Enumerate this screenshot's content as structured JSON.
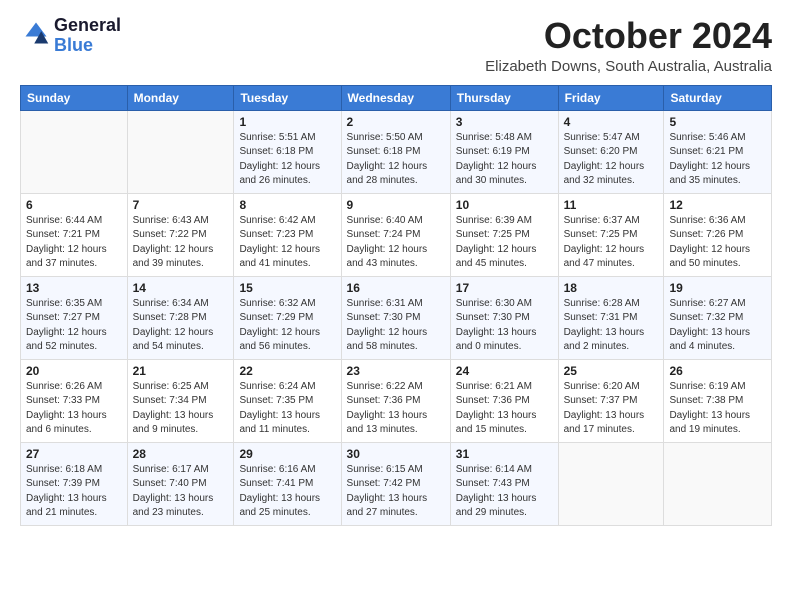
{
  "header": {
    "logo_line1": "General",
    "logo_line2": "Blue",
    "month_title": "October 2024",
    "location": "Elizabeth Downs, South Australia, Australia"
  },
  "days_of_week": [
    "Sunday",
    "Monday",
    "Tuesday",
    "Wednesday",
    "Thursday",
    "Friday",
    "Saturday"
  ],
  "weeks": [
    [
      {
        "num": "",
        "info": ""
      },
      {
        "num": "",
        "info": ""
      },
      {
        "num": "1",
        "info": "Sunrise: 5:51 AM\nSunset: 6:18 PM\nDaylight: 12 hours\nand 26 minutes."
      },
      {
        "num": "2",
        "info": "Sunrise: 5:50 AM\nSunset: 6:18 PM\nDaylight: 12 hours\nand 28 minutes."
      },
      {
        "num": "3",
        "info": "Sunrise: 5:48 AM\nSunset: 6:19 PM\nDaylight: 12 hours\nand 30 minutes."
      },
      {
        "num": "4",
        "info": "Sunrise: 5:47 AM\nSunset: 6:20 PM\nDaylight: 12 hours\nand 32 minutes."
      },
      {
        "num": "5",
        "info": "Sunrise: 5:46 AM\nSunset: 6:21 PM\nDaylight: 12 hours\nand 35 minutes."
      }
    ],
    [
      {
        "num": "6",
        "info": "Sunrise: 6:44 AM\nSunset: 7:21 PM\nDaylight: 12 hours\nand 37 minutes."
      },
      {
        "num": "7",
        "info": "Sunrise: 6:43 AM\nSunset: 7:22 PM\nDaylight: 12 hours\nand 39 minutes."
      },
      {
        "num": "8",
        "info": "Sunrise: 6:42 AM\nSunset: 7:23 PM\nDaylight: 12 hours\nand 41 minutes."
      },
      {
        "num": "9",
        "info": "Sunrise: 6:40 AM\nSunset: 7:24 PM\nDaylight: 12 hours\nand 43 minutes."
      },
      {
        "num": "10",
        "info": "Sunrise: 6:39 AM\nSunset: 7:25 PM\nDaylight: 12 hours\nand 45 minutes."
      },
      {
        "num": "11",
        "info": "Sunrise: 6:37 AM\nSunset: 7:25 PM\nDaylight: 12 hours\nand 47 minutes."
      },
      {
        "num": "12",
        "info": "Sunrise: 6:36 AM\nSunset: 7:26 PM\nDaylight: 12 hours\nand 50 minutes."
      }
    ],
    [
      {
        "num": "13",
        "info": "Sunrise: 6:35 AM\nSunset: 7:27 PM\nDaylight: 12 hours\nand 52 minutes."
      },
      {
        "num": "14",
        "info": "Sunrise: 6:34 AM\nSunset: 7:28 PM\nDaylight: 12 hours\nand 54 minutes."
      },
      {
        "num": "15",
        "info": "Sunrise: 6:32 AM\nSunset: 7:29 PM\nDaylight: 12 hours\nand 56 minutes."
      },
      {
        "num": "16",
        "info": "Sunrise: 6:31 AM\nSunset: 7:30 PM\nDaylight: 12 hours\nand 58 minutes."
      },
      {
        "num": "17",
        "info": "Sunrise: 6:30 AM\nSunset: 7:30 PM\nDaylight: 13 hours\nand 0 minutes."
      },
      {
        "num": "18",
        "info": "Sunrise: 6:28 AM\nSunset: 7:31 PM\nDaylight: 13 hours\nand 2 minutes."
      },
      {
        "num": "19",
        "info": "Sunrise: 6:27 AM\nSunset: 7:32 PM\nDaylight: 13 hours\nand 4 minutes."
      }
    ],
    [
      {
        "num": "20",
        "info": "Sunrise: 6:26 AM\nSunset: 7:33 PM\nDaylight: 13 hours\nand 6 minutes."
      },
      {
        "num": "21",
        "info": "Sunrise: 6:25 AM\nSunset: 7:34 PM\nDaylight: 13 hours\nand 9 minutes."
      },
      {
        "num": "22",
        "info": "Sunrise: 6:24 AM\nSunset: 7:35 PM\nDaylight: 13 hours\nand 11 minutes."
      },
      {
        "num": "23",
        "info": "Sunrise: 6:22 AM\nSunset: 7:36 PM\nDaylight: 13 hours\nand 13 minutes."
      },
      {
        "num": "24",
        "info": "Sunrise: 6:21 AM\nSunset: 7:36 PM\nDaylight: 13 hours\nand 15 minutes."
      },
      {
        "num": "25",
        "info": "Sunrise: 6:20 AM\nSunset: 7:37 PM\nDaylight: 13 hours\nand 17 minutes."
      },
      {
        "num": "26",
        "info": "Sunrise: 6:19 AM\nSunset: 7:38 PM\nDaylight: 13 hours\nand 19 minutes."
      }
    ],
    [
      {
        "num": "27",
        "info": "Sunrise: 6:18 AM\nSunset: 7:39 PM\nDaylight: 13 hours\nand 21 minutes."
      },
      {
        "num": "28",
        "info": "Sunrise: 6:17 AM\nSunset: 7:40 PM\nDaylight: 13 hours\nand 23 minutes."
      },
      {
        "num": "29",
        "info": "Sunrise: 6:16 AM\nSunset: 7:41 PM\nDaylight: 13 hours\nand 25 minutes."
      },
      {
        "num": "30",
        "info": "Sunrise: 6:15 AM\nSunset: 7:42 PM\nDaylight: 13 hours\nand 27 minutes."
      },
      {
        "num": "31",
        "info": "Sunrise: 6:14 AM\nSunset: 7:43 PM\nDaylight: 13 hours\nand 29 minutes."
      },
      {
        "num": "",
        "info": ""
      },
      {
        "num": "",
        "info": ""
      }
    ]
  ]
}
